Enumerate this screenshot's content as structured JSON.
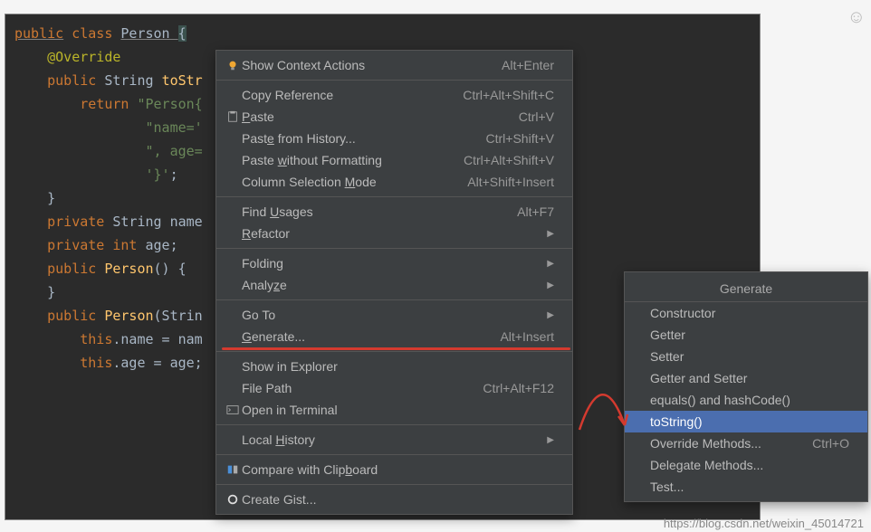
{
  "code": {
    "l1a": "public",
    "l1b": " class ",
    "l1c": "Person ",
    "l1d": "{",
    "l2": "    @Override",
    "l3a": "    public ",
    "l3b": "String ",
    "l3c": "toStr",
    "l4a": "        return ",
    "l4b": "\"Person{",
    "l5": "                \"name='",
    "l6": "                \", age=",
    "l7": "                '}'",
    "l7b": ";",
    "l8": "    }",
    "l9": "",
    "l10a": "    private ",
    "l10b": "String ",
    "l10c": "name",
    "l11a": "    private ",
    "l11b": "int ",
    "l11c": "age",
    "l11d": ";",
    "l12": "",
    "l13a": "    public ",
    "l13b": "Person",
    "l13c": "() {",
    "l14": "    }",
    "l15": "",
    "l16a": "    public ",
    "l16b": "Person",
    "l16c": "(Strin",
    "l17a": "        this",
    "l17b": ".name = nam",
    "l18a": "        this",
    "l18b": ".age = age;"
  },
  "context_menu": [
    {
      "icon": "bulb",
      "label": "Show Context Actions",
      "shortcut": "Alt+Enter"
    },
    {
      "sep": true
    },
    {
      "label": "Copy Reference",
      "shortcut": "Ctrl+Alt+Shift+C",
      "u": ""
    },
    {
      "icon": "paste",
      "label": "Paste",
      "shortcut": "Ctrl+V",
      "u": "P"
    },
    {
      "label": "Paste from History...",
      "shortcut": "Ctrl+Shift+V",
      "u": "e"
    },
    {
      "label": "Paste without Formatting",
      "shortcut": "Ctrl+Alt+Shift+V",
      "u": "w"
    },
    {
      "label": "Column Selection Mode",
      "shortcut": "Alt+Shift+Insert",
      "u": "M"
    },
    {
      "sep": true
    },
    {
      "label": "Find Usages",
      "shortcut": "Alt+F7",
      "u": "U"
    },
    {
      "label": "Refactor",
      "submenu": true,
      "u": "R"
    },
    {
      "sep": true
    },
    {
      "label": "Folding",
      "submenu": true
    },
    {
      "label": "Analyze",
      "submenu": true,
      "u": "z"
    },
    {
      "sep": true
    },
    {
      "label": "Go To",
      "submenu": true
    },
    {
      "label": "Generate...",
      "shortcut": "Alt+Insert",
      "u": "G"
    },
    {
      "sep": true
    },
    {
      "label": "Show in Explorer"
    },
    {
      "label": "File Path",
      "shortcut": "Ctrl+Alt+F12",
      "u": ""
    },
    {
      "icon": "terminal",
      "label": "Open in Terminal"
    },
    {
      "sep": true
    },
    {
      "label": "Local History",
      "submenu": true,
      "u": "H"
    },
    {
      "sep": true
    },
    {
      "icon": "compare",
      "label": "Compare with Clipboard",
      "u": "b"
    },
    {
      "sep": true
    },
    {
      "icon": "github",
      "label": "Create Gist..."
    }
  ],
  "generate_menu": {
    "title": "Generate",
    "items": [
      {
        "label": "Constructor"
      },
      {
        "label": "Getter"
      },
      {
        "label": "Setter"
      },
      {
        "label": "Getter and Setter"
      },
      {
        "label": "equals() and hashCode()"
      },
      {
        "label": "toString()",
        "hi": true
      },
      {
        "label": "Override Methods...",
        "shortcut": "Ctrl+O"
      },
      {
        "label": "Delegate Methods..."
      },
      {
        "label": "Test..."
      }
    ]
  },
  "watermark": "https://blog.csdn.net/weixin_45014721"
}
